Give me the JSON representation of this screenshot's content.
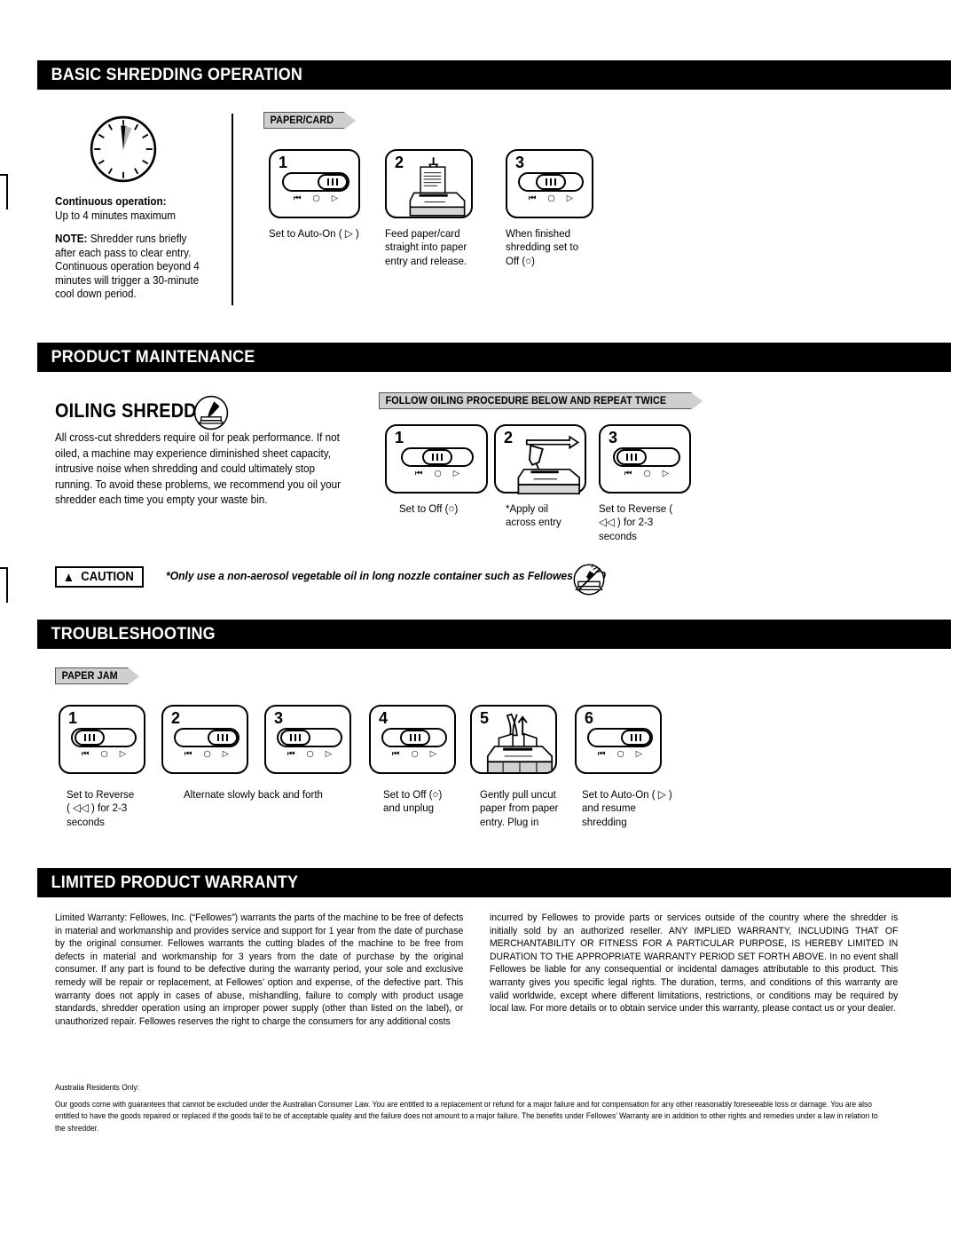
{
  "sections": {
    "basic": {
      "title": "BASIC SHREDDING OPERATION",
      "clock_icon": "clock-icon",
      "continuous_label": "Continuous operation:",
      "continuous_value": "Up to 4 minutes maximum",
      "note_label": "NOTE:",
      "note_text": " Shredder runs briefly after each pass to clear entry. Continuous operation beyond 4 minutes will trigger a 30-minute cool down period.",
      "tag": "PAPER/CARD",
      "steps": [
        {
          "num": "1",
          "caption": "Set to Auto-On ( ▷ )",
          "icon": "switch-icon",
          "knob": "right"
        },
        {
          "num": "2",
          "caption": "Feed paper/card straight into paper entry and release.",
          "icon": "shredder-feed-paper-icon"
        },
        {
          "num": "3",
          "caption": "When finished shredding set to Off (○)",
          "icon": "switch-icon",
          "knob": "center"
        }
      ]
    },
    "maintenance": {
      "title": "PRODUCT MAINTENANCE",
      "headline": "OILING SHREDDER",
      "headline_icon": "oil-bottle-icon",
      "body": "All cross-cut shredders require oil for peak performance. If not oiled, a machine may experience diminished sheet capacity, intrusive noise when shredding and could ultimately stop running. To avoid these problems, we recommend you oil your shredder each time you empty your waste bin.",
      "tag": "FOLLOW OILING PROCEDURE BELOW AND REPEAT TWICE",
      "steps": [
        {
          "num": "1",
          "caption": "Set to Off (○)",
          "icon": "switch-icon",
          "knob": "center"
        },
        {
          "num": "2",
          "caption": "*Apply oil across entry",
          "icon": "oil-applying-icon"
        },
        {
          "num": "3",
          "caption": "Set to Reverse ( ◁◁ ) for 2-3 seconds",
          "icon": "switch-icon",
          "knob": "left"
        }
      ]
    },
    "caution": {
      "label": "CAUTION",
      "warning_icon": "warning-triangle-icon",
      "text": "*Only use a non-aerosol vegetable oil in long nozzle container such as Fellowes 35250",
      "prohibition_icon": "no-aerosol-icon"
    },
    "troubleshooting": {
      "title": "TROUBLESHOOTING",
      "tag": "PAPER JAM",
      "steps": [
        {
          "num": "1",
          "caption": "Set to Reverse ( ◁◁ ) for 2-3 seconds",
          "icon": "switch-icon",
          "knob": "left"
        },
        {
          "num": "2",
          "caption": "Alternate slowly back and forth",
          "icon": "switch-icon",
          "knob": "right"
        },
        {
          "num": "3",
          "caption": "",
          "icon": "switch-icon",
          "knob": "left"
        },
        {
          "num": "4",
          "caption": "Set to Off (○) and unplug",
          "icon": "switch-icon",
          "knob": "center"
        },
        {
          "num": "5",
          "caption": "Gently pull uncut paper from paper entry. Plug in",
          "icon": "pull-paper-icon"
        },
        {
          "num": "6",
          "caption": "Set to Auto-On ( ▷ ) and resume shredding",
          "icon": "switch-icon",
          "knob": "right"
        }
      ]
    },
    "warranty": {
      "title": "LIMITED PRODUCT WARRANTY",
      "column_left": "Limited Warranty:  Fellowes, Inc. (“Fellowes”) warrants the parts of the machine to be free of defects in material and workmanship and provides service and support for 1 year from the date of purchase by the original consumer.  Fellowes warrants the cutting blades of the machine to be free from defects in material and workmanship for 3 years from the date of purchase by the original consumer. If any part is found to be defective during the warranty period, your sole and exclusive remedy will be repair or replacement, at Fellowes’ option and expense, of the defective part. This warranty does not apply in cases of abuse, mishandling, failure to comply with product usage standards, shredder operation using an improper power supply (other than listed on the label), or unauthorized repair. Fellowes reserves the right to charge the consumers for any additional costs",
      "column_right": "incurred by Fellowes to provide parts or services outside of the country where the shredder is initially sold by an authorized reseller. ANY IMPLIED WARRANTY, INCLUDING THAT OF MERCHANTABILITY OR FITNESS FOR A PARTICULAR PURPOSE, IS HEREBY LIMITED IN DURATION TO THE APPROPRIATE WARRANTY PERIOD SET FORTH ABOVE. In no event shall Fellowes be liable for any consequential or incidental damages attributable to this product. This warranty gives you specific legal rights. The duration, terms, and conditions of this warranty are valid worldwide, except where different limitations, restrictions, or conditions may be required by local law. For more details or to obtain service under this warranty, please contact us or your dealer.",
      "australia_heading": "Australia Residents Only:",
      "australia_body": "Our goods come with guarantees that cannot be excluded under the Australian Consumer Law. You are entitled to a replacement or refund for a major failure and for compensation for any other reasonably foreseeable loss or damage. You are also entitled to have the goods repaired or replaced if the goods fail to be of acceptable quality and the failure does not amount to a major failure.  The benefits under Fellowes’ Warranty are in addition to other rights and remedies under a  law in relation to the shredder."
    }
  },
  "switch_marks": {
    "reverse": "⏪",
    "off": "○",
    "forward": "▷"
  }
}
